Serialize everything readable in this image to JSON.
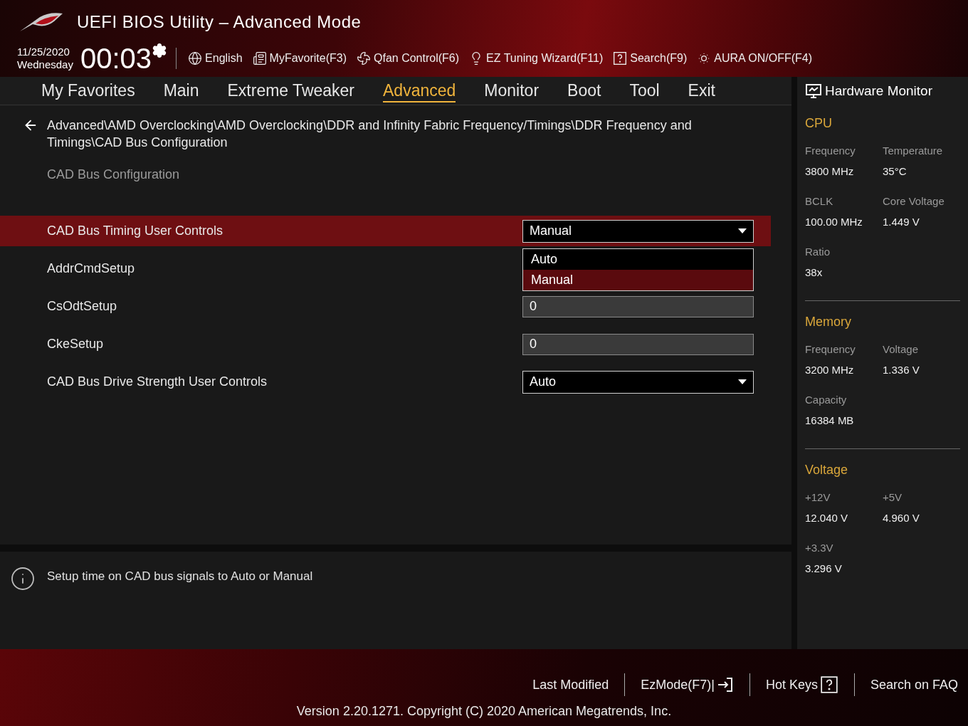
{
  "header": {
    "title": "UEFI BIOS Utility – Advanced Mode",
    "date": "11/25/2020",
    "day": "Wednesday",
    "time": "00:03",
    "tools": [
      {
        "kind": "globe",
        "label": "English"
      },
      {
        "kind": "list",
        "label": "MyFavorite(F3)"
      },
      {
        "kind": "fan",
        "label": "Qfan Control(F6)"
      },
      {
        "kind": "bulb",
        "label": "EZ Tuning Wizard(F11)"
      },
      {
        "kind": "help",
        "label": "Search(F9)"
      },
      {
        "kind": "light",
        "label": "AURA ON/OFF(F4)"
      }
    ]
  },
  "tabs": [
    {
      "label": "My Favorites",
      "selected": false
    },
    {
      "label": "Main",
      "selected": false
    },
    {
      "label": "Extreme Tweaker",
      "selected": false
    },
    {
      "label": "Advanced",
      "selected": true
    },
    {
      "label": "Monitor",
      "selected": false
    },
    {
      "label": "Boot",
      "selected": false
    },
    {
      "label": "Tool",
      "selected": false
    },
    {
      "label": "Exit",
      "selected": false
    }
  ],
  "breadcrumb": "Advanced\\AMD Overclocking\\AMD Overclocking\\DDR and Infinity Fabric Frequency/Timings\\DDR Frequency and Timings\\CAD Bus Configuration",
  "section_title": "CAD Bus Configuration",
  "settings": [
    {
      "label": "CAD Bus Timing User Controls",
      "kind": "dropdown",
      "value": "Manual",
      "selected": true,
      "expanded": true,
      "options": [
        {
          "label": "Auto",
          "selected": false
        },
        {
          "label": "Manual",
          "selected": true
        }
      ]
    },
    {
      "label": "AddrCmdSetup",
      "kind": "covered",
      "selected": false
    },
    {
      "label": "CsOdtSetup",
      "kind": "input",
      "value": "0",
      "selected": false
    },
    {
      "label": "CkeSetup",
      "kind": "input",
      "value": "0",
      "selected": false
    },
    {
      "label": "CAD Bus Drive Strength User Controls",
      "kind": "dropdown",
      "value": "Auto",
      "selected": false
    }
  ],
  "help": "Setup time on CAD bus signals to Auto or Manual",
  "hardware_monitor": {
    "title": "Hardware Monitor",
    "sections": [
      {
        "title": "CPU",
        "items": [
          {
            "label": "Frequency",
            "value": "3800 MHz"
          },
          {
            "label": "Temperature",
            "value": "35°C"
          },
          {
            "label": "BCLK",
            "value": "100.00 MHz"
          },
          {
            "label": "Core Voltage",
            "value": "1.449 V"
          },
          {
            "label": "Ratio",
            "value": "38x"
          }
        ]
      },
      {
        "title": "Memory",
        "items": [
          {
            "label": "Frequency",
            "value": "3200 MHz"
          },
          {
            "label": "Voltage",
            "value": "1.336 V"
          },
          {
            "label": "Capacity",
            "value": "16384 MB"
          }
        ]
      },
      {
        "title": "Voltage",
        "items": [
          {
            "label": "+12V",
            "value": "12.040 V"
          },
          {
            "label": "+5V",
            "value": "4.960 V"
          },
          {
            "label": "+3.3V",
            "value": "3.296 V"
          }
        ]
      }
    ]
  },
  "footer": {
    "links": [
      {
        "label": "Last Modified",
        "kind": "plain"
      },
      {
        "label": "EzMode(F7)|",
        "kind": "exit"
      },
      {
        "label": "Hot Keys",
        "kind": "help"
      },
      {
        "label": "Search on FAQ",
        "kind": "plain"
      }
    ],
    "version": "Version 2.20.1271. Copyright (C) 2020 American Megatrends, Inc."
  }
}
